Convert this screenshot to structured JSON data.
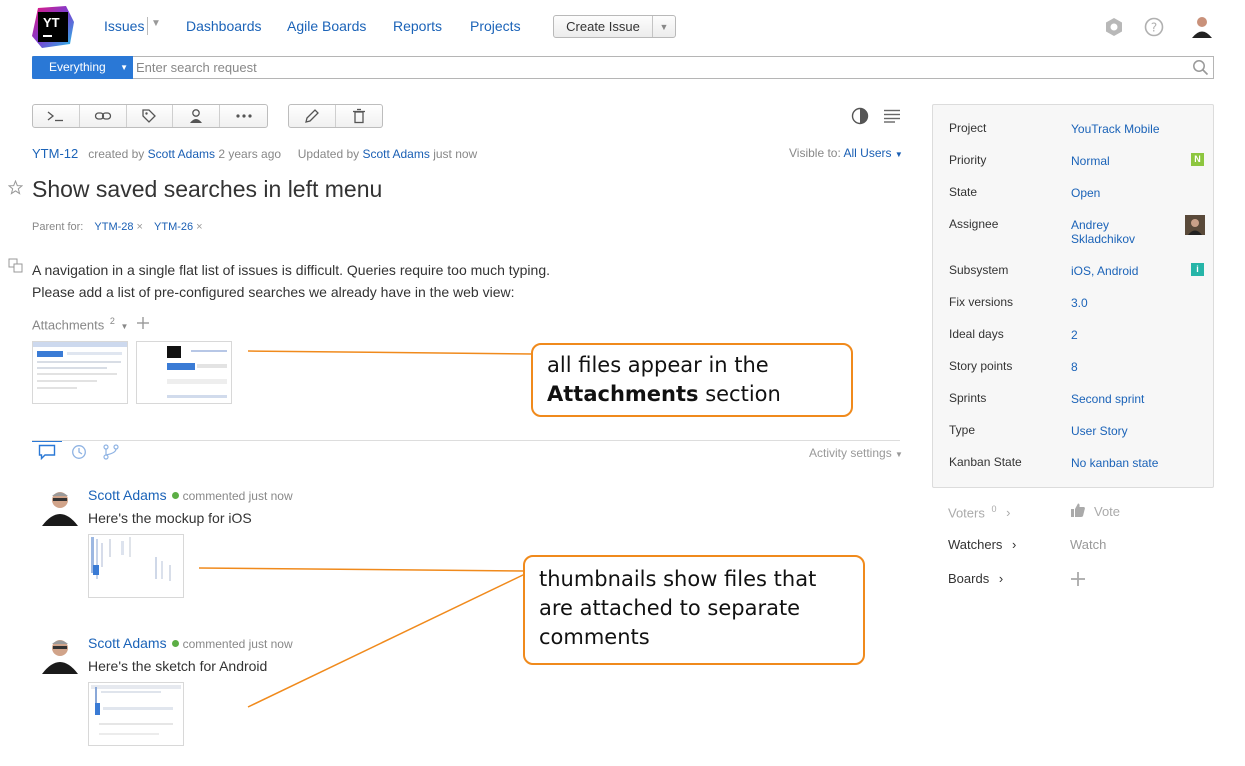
{
  "header": {
    "logo_text": "YT",
    "nav": [
      "Issues",
      "Dashboards",
      "Agile Boards",
      "Reports",
      "Projects"
    ],
    "create_issue": "Create Issue"
  },
  "search": {
    "context": "Everything",
    "placeholder": "Enter search request"
  },
  "issue": {
    "id": "YTM-12",
    "created_by_prefix": "created by",
    "creator": "Scott Adams",
    "created_ago": "2 years ago",
    "updated_prefix": "Updated by",
    "updater": "Scott Adams",
    "updated_ago": "just now",
    "visible_to_label": "Visible to:",
    "visible_to": "All Users",
    "title": "Show saved searches in left menu",
    "parent_label": "Parent for:",
    "parents": [
      "YTM-28",
      "YTM-26"
    ],
    "description_lines": [
      "A navigation in a single flat list of issues is difficult. Queries require too much typing.",
      "Please add a list of pre-configured searches we already have in the web view:"
    ],
    "attachments_label": "Attachments",
    "attachments_count": "2"
  },
  "activity": {
    "settings_label": "Activity settings",
    "comments": [
      {
        "author": "Scott Adams",
        "meta": "commented just now",
        "text": "Here's the mockup for iOS"
      },
      {
        "author": "Scott Adams",
        "meta": "commented just now",
        "text": "Here's the sketch for Android"
      }
    ]
  },
  "fields": [
    {
      "name": "Project",
      "value": "YouTrack Mobile"
    },
    {
      "name": "Priority",
      "value": "Normal",
      "badge": "N",
      "badge_color": "#8dc63f"
    },
    {
      "name": "State",
      "value": "Open"
    },
    {
      "name": "Assignee",
      "value": "Andrey Skladchikov"
    },
    {
      "name": "Subsystem",
      "value": "iOS, Android",
      "badge": "i",
      "badge_color": "#26b5a8"
    },
    {
      "name": "Fix versions",
      "value": "3.0"
    },
    {
      "name": "Ideal days",
      "value": "2"
    },
    {
      "name": "Story points",
      "value": "8"
    },
    {
      "name": "Sprints",
      "value": "Second sprint"
    },
    {
      "name": "Type",
      "value": "User Story"
    },
    {
      "name": "Kanban State",
      "value": "No kanban state"
    }
  ],
  "social": {
    "voters_label": "Voters",
    "voters_count": "0",
    "vote_label": "Vote",
    "watchers_label": "Watchers",
    "watch_label": "Watch",
    "boards_label": "Boards"
  },
  "callouts": {
    "attachments_line1": "all files appear in the",
    "attachments_bold": "Attachments",
    "attachments_rest": " section",
    "thumbnails": "thumbnails show files that are attached to separate comments"
  },
  "colors": {
    "accent": "#1b63b8",
    "primary_button": "#2a78d6",
    "callout_border": "#f08a1c"
  }
}
